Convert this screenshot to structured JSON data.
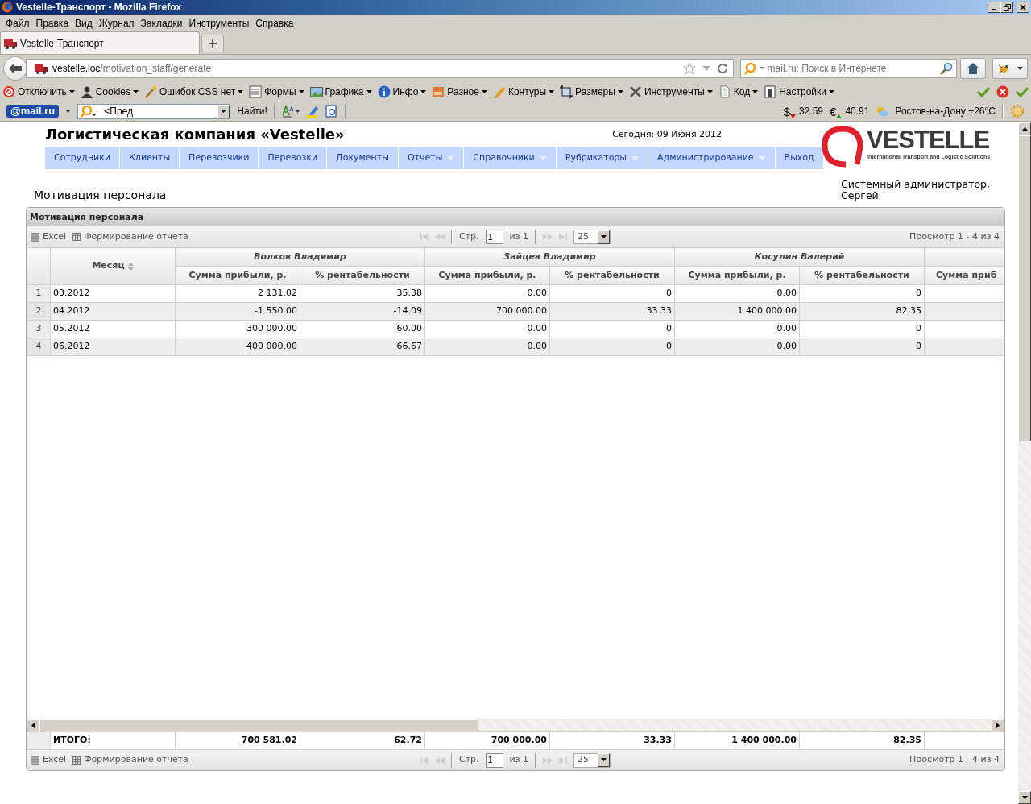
{
  "window": {
    "title": "Vestelle-Транспорт - Mozilla Firefox"
  },
  "menu": [
    "Файл",
    "Правка",
    "Вид",
    "Журнал",
    "Закладки",
    "Инструменты",
    "Справка"
  ],
  "tabs": [
    {
      "label": "Vestelle-Транспорт",
      "selected": true
    }
  ],
  "address": {
    "host": "vestelle.loc",
    "path": "/motivation_staff/generate"
  },
  "web_search": {
    "placeholder": "mail.ru: Поиск в Интернете"
  },
  "developer_toolbar": [
    {
      "label": "Отключить"
    },
    {
      "label": "Cookies"
    },
    {
      "label": "Ошибок CSS нет"
    },
    {
      "label": "Формы"
    },
    {
      "label": "Графика"
    },
    {
      "label": "Инфо"
    },
    {
      "label": "Разное"
    },
    {
      "label": "Контуры"
    },
    {
      "label": "Размеры"
    },
    {
      "label": "Инструменты"
    },
    {
      "label": "Код"
    },
    {
      "label": "Настройки"
    }
  ],
  "mail_bar": {
    "logo": "@mail.ru",
    "search_value": "<Пред",
    "find_button": "Найти!",
    "rates": [
      {
        "symbol": "$",
        "rising": false,
        "value": "32.59"
      },
      {
        "symbol": "€",
        "rising": true,
        "value": "40.91"
      }
    ],
    "weather": "Ростов-на-Дону +26°C"
  },
  "site": {
    "title": "Логистическая компания «Vestelle»",
    "date": "Сегодня: 09 Июня 2012",
    "nav": [
      {
        "label": "Сотрудники",
        "dropdown": false
      },
      {
        "label": "Клиенты",
        "dropdown": false
      },
      {
        "label": "Перевозчики",
        "dropdown": false
      },
      {
        "label": "Перевозки",
        "dropdown": false
      },
      {
        "label": "Документы",
        "dropdown": false
      },
      {
        "label": "Отчеты",
        "dropdown": true
      },
      {
        "label": "Справочники",
        "dropdown": true
      },
      {
        "label": "Рубрикаторы",
        "dropdown": true
      },
      {
        "label": "Администрирование",
        "dropdown": true
      },
      {
        "label": "Выход",
        "dropdown": false
      }
    ],
    "logo": {
      "name": "VESTELLE",
      "tagline": "International Transport and Logistic Solutions"
    },
    "user": "Системный администратор, Сергей",
    "heading": "Мотивация персонала"
  },
  "grid": {
    "caption": "Мотивация персонала",
    "toolbars": [
      {
        "excel": "Excel",
        "report": "Формирование отчета",
        "page_label": "Стр.",
        "page": "1",
        "page_count": "из 1",
        "page_size": "25",
        "summary": "Просмотр 1 - 4 из 4"
      },
      {
        "excel": "Excel",
        "report": "Формирование отчета",
        "page_label": "Стр.",
        "page": "1",
        "page_count": "из 1",
        "page_size": "25",
        "summary": "Просмотр 1 - 4 из 4"
      }
    ],
    "month_column": "Месяц",
    "groups": [
      {
        "name": "Волков Владимир",
        "columns": [
          "Сумма прибыли, р.",
          "% рентабельности"
        ]
      },
      {
        "name": "Зайцев Владимир",
        "columns": [
          "Сумма прибыли, р.",
          "% рентабельности"
        ]
      },
      {
        "name": "Косулин Валерий",
        "columns": [
          "Сумма прибыли, р.",
          "% рентабельности"
        ]
      },
      {
        "columns": [
          "Сумма приб"
        ]
      }
    ],
    "rows": [
      {
        "number": "1",
        "month": "03.2012",
        "values": [
          "2 131.02",
          "35.38",
          "0.00",
          "0",
          "0.00",
          "0"
        ]
      },
      {
        "number": "2",
        "month": "04.2012",
        "values": [
          "-1 550.00",
          "-14.09",
          "700 000.00",
          "33.33",
          "1 400 000.00",
          "82.35"
        ]
      },
      {
        "number": "3",
        "month": "05.2012",
        "values": [
          "300 000.00",
          "60.00",
          "0.00",
          "0",
          "0.00",
          "0"
        ]
      },
      {
        "number": "4",
        "month": "06.2012",
        "values": [
          "400 000.00",
          "66.67",
          "0.00",
          "0",
          "0.00",
          "0"
        ]
      }
    ],
    "totals": {
      "label": "ИТОГО:",
      "values": [
        "700 581.02",
        "62.72",
        "700 000.00",
        "33.33",
        "1 400 000.00",
        "82.35"
      ]
    }
  }
}
